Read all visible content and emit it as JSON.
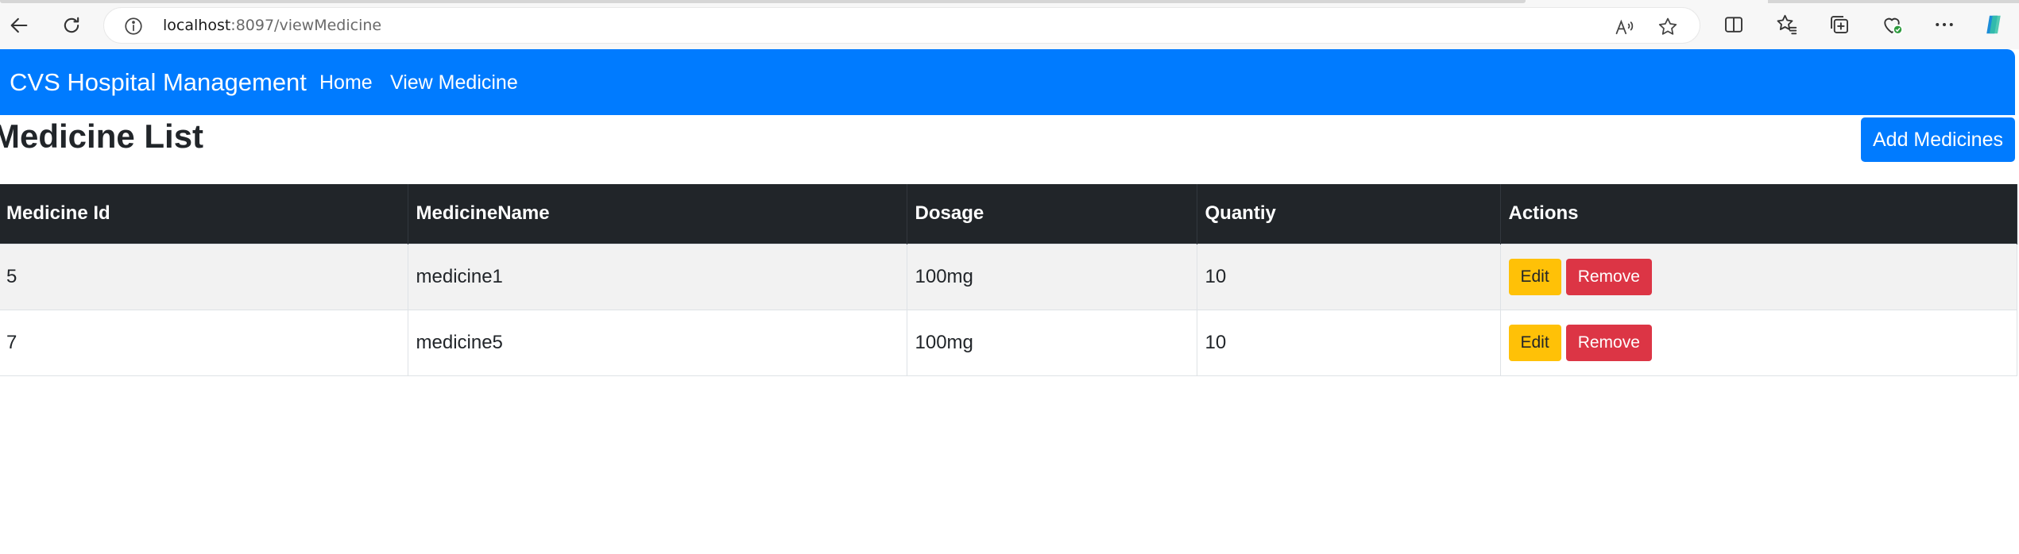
{
  "browser": {
    "url_host": "localhost",
    "url_rest": ":8097/viewMedicine"
  },
  "navbar": {
    "brand": "CVS Hospital Management",
    "links": [
      "Home",
      "View Medicine"
    ]
  },
  "page": {
    "title": "Medicine List",
    "add_button": "Add Medicines"
  },
  "table": {
    "headers": [
      "Medicine Id",
      "MedicineName",
      "Dosage",
      "Quantiy",
      "Actions"
    ],
    "rows": [
      {
        "id": "5",
        "name": "medicine1",
        "dosage": "100mg",
        "quantity": "10"
      },
      {
        "id": "7",
        "name": "medicine5",
        "dosage": "100mg",
        "quantity": "10"
      }
    ],
    "edit_label": "Edit",
    "remove_label": "Remove"
  },
  "colors": {
    "navbar": "#007bff",
    "table_header": "#212529",
    "edit": "#ffc107",
    "remove": "#dc3545"
  },
  "icons": [
    "back-icon",
    "refresh-icon",
    "info-icon",
    "read-aloud-icon",
    "favorite-star-icon",
    "split-screen-icon",
    "favorites-icon",
    "collections-icon",
    "browser-essentials-icon",
    "more-icon",
    "copilot-icon"
  ]
}
